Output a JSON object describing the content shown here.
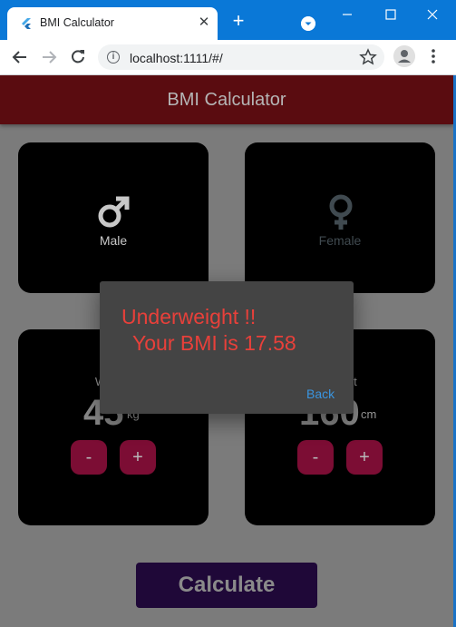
{
  "browser": {
    "tab_title": "BMI Calculator",
    "url": "localhost:1111/#/",
    "close_glyph": "✕",
    "new_tab_glyph": "+"
  },
  "app": {
    "title": "BMI Calculator",
    "gender": {
      "male_label": "Male",
      "female_label": "Female",
      "selected": "Male"
    },
    "weight": {
      "label": "Weight",
      "value": "45",
      "unit": "kg",
      "minus_label": "-",
      "plus_label": "+"
    },
    "height": {
      "label": "Height",
      "value": "160",
      "unit": "cm",
      "minus_label": "-",
      "plus_label": "+"
    },
    "calculate_label": "Calculate"
  },
  "dialog": {
    "line1": "Underweight !!",
    "line2": "Your BMI is 17.58",
    "back_label": "Back"
  },
  "colors": {
    "chrome_blue": "#0a78d7",
    "appbar": "#5a0c10",
    "dialog_text": "#e8403a",
    "dialog_link": "#3a95e0",
    "button": "#7c0d34",
    "calculate_bg": "#1f0838"
  }
}
